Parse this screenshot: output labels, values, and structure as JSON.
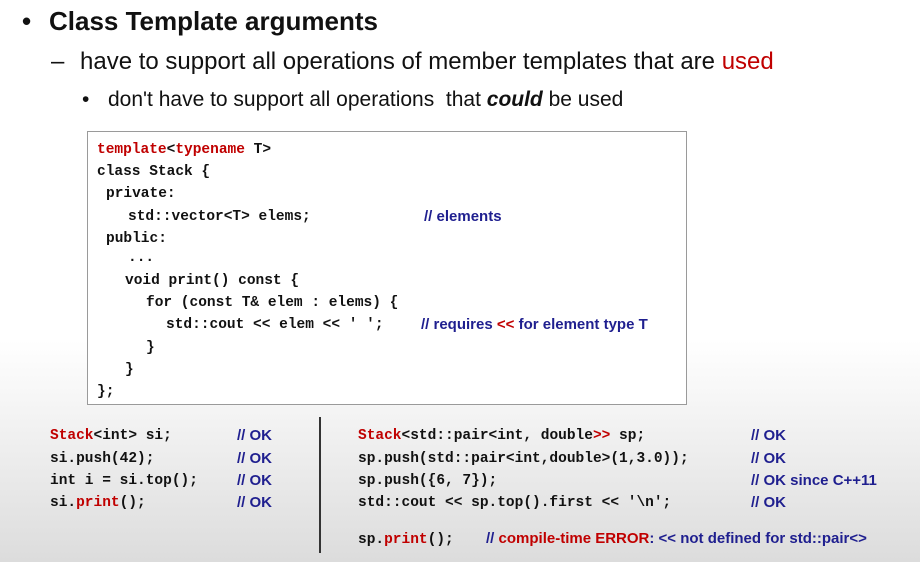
{
  "bullets": {
    "l1": "Class Template arguments",
    "l2_prefix": "have to support all operations of member templates that are ",
    "l2_highlight": "used",
    "l3_prefix": "don't have to support all operations  that ",
    "l3_emph": "could",
    "l3_suffix": " be used"
  },
  "code": {
    "line1_kw1": "template",
    "line1_lt": "<",
    "line1_kw2": "typename",
    "line1_rest": " T>",
    "line2": "class Stack {",
    "line3": "private:",
    "line4": "std::vector<T> elems;",
    "line4_comment": "// elements",
    "line5": "public:",
    "line6": "...",
    "line7": "void print() const {",
    "line8": "for (const T& elem : elems) {",
    "line9": "std::cout << elem << ' ';",
    "line9_comment_a": "// requires ",
    "line9_comment_op": "<<",
    "line9_comment_b": " for element type T",
    "line10": "}",
    "line11": "}",
    "line12": "};"
  },
  "left_examples": [
    {
      "code_hl": "Stack",
      "code_rest": "<int> si;",
      "comment": "// OK"
    },
    {
      "code_hl": "",
      "code_rest": "si.push(42);",
      "comment": "// OK"
    },
    {
      "code_hl": "",
      "code_rest": "int i = si.top();",
      "comment": "// OK"
    },
    {
      "code_pre": "si.",
      "code_hl": "print",
      "code_rest": "();",
      "comment": "// OK"
    }
  ],
  "right_examples": [
    {
      "code_hl": "Stack",
      "code_rest": "<std::pair<int, double",
      "code_hl2": ">>",
      "code_rest2": " sp;",
      "comment": "// OK"
    },
    {
      "code_rest": "sp.push(std::pair<int,double>(1,3.0));",
      "comment": "// OK"
    },
    {
      "code_rest": "sp.push({6, 7});",
      "comment": "// OK since C++11"
    },
    {
      "code_rest": "std::cout << sp.top().first << '\\n';",
      "comment": "// OK"
    }
  ],
  "error_line": {
    "code_pre": "sp.",
    "code_hl": "print",
    "code_rest": "();",
    "comment_prefix": "// ",
    "comment_error": "compile-time ERROR",
    "comment_suffix": ": << not defined for std::pair<>"
  }
}
